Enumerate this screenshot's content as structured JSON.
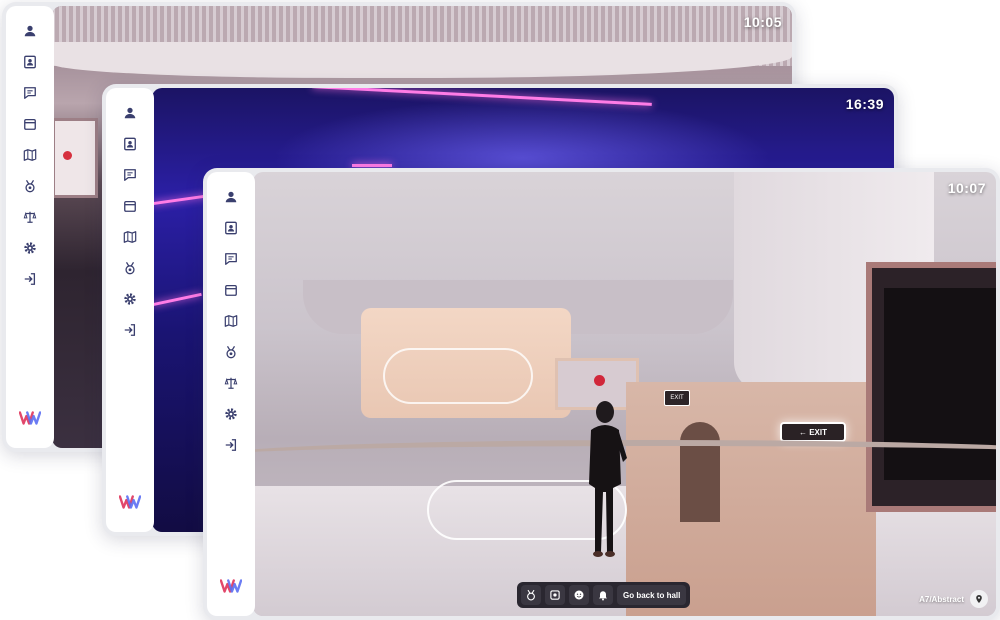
{
  "sidebar_icons": {
    "full": [
      "user-icon",
      "contact-card-icon",
      "chat-icon",
      "calendar-icon",
      "map-icon",
      "medal-icon",
      "scales-icon",
      "gear-icon",
      "logout-icon"
    ],
    "short": [
      "user-icon",
      "contact-card-icon",
      "chat-icon",
      "calendar-icon",
      "map-icon",
      "medal-icon",
      "gear-icon",
      "logout-icon"
    ]
  },
  "brand_logo": "W",
  "windows": [
    {
      "clock": "10:05"
    },
    {
      "clock": "16:39"
    },
    {
      "clock": "10:07"
    }
  ],
  "scene": {
    "exit_sign": "← EXIT",
    "exit_small": "EXIT"
  },
  "toolbar": {
    "icons": [
      "medal-icon",
      "badge-icon",
      "emoji-icon",
      "bell-icon"
    ],
    "hall_button": "Go back to hall"
  },
  "location": {
    "label": "A7/Abstract"
  },
  "colors": {
    "accent": "#d1273a",
    "sidebar_icon": "#3a3f6e",
    "toolbar_bg": "#2a2730"
  }
}
